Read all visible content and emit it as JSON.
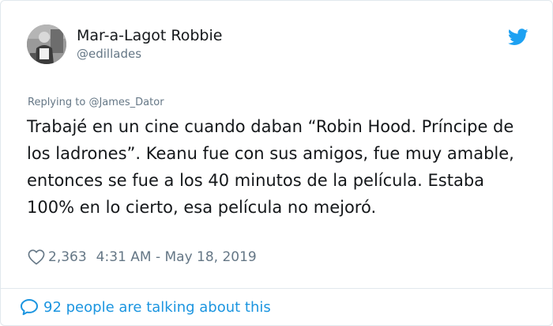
{
  "author": {
    "display_name": "Mar-a-Lagot Robbie",
    "handle": "@edillades",
    "avatar_icon": "user-photo-avatar"
  },
  "platform_icon": "twitter-bird-icon",
  "reply": {
    "prefix": "Replying to ",
    "mention": "@James_Dator"
  },
  "tweet": {
    "text": "Trabajé en un cine cuando daban “Robin Hood. Príncipe de los ladrones”. Keanu fue con sus amigos, fue muy amable, entonces se fue a los 40 minutos de la película. Estaba 100% en lo cierto, esa película no mejoró."
  },
  "meta": {
    "like_icon": "heart-icon",
    "like_count": "2,363",
    "timestamp": "4:31 AM - May 18, 2019"
  },
  "conversation": {
    "icon": "speech-bubble-icon",
    "label": "92 people are talking about this"
  },
  "colors": {
    "accent": "#1b95e0",
    "secondary_text": "#657786",
    "primary_text": "#14171a",
    "border": "#e1e8ed"
  }
}
